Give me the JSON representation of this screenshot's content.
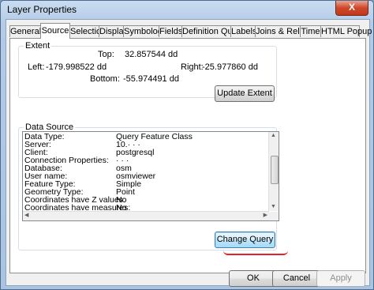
{
  "window": {
    "title": "Layer Properties",
    "close_glyph": "X"
  },
  "tabs": [
    {
      "label": "General"
    },
    {
      "label": "Source"
    },
    {
      "label": "Selection"
    },
    {
      "label": "Display"
    },
    {
      "label": "Symbology"
    },
    {
      "label": "Fields"
    },
    {
      "label": "Definition Query"
    },
    {
      "label": "Labels"
    },
    {
      "label": "Joins & Relates"
    },
    {
      "label": "Time"
    },
    {
      "label": "HTML Popup"
    }
  ],
  "active_tab": "Source",
  "extent": {
    "group_label": "Extent",
    "top_label": "Top:",
    "top_value": "32.857544 dd",
    "left_label": "Left:",
    "left_value": "-179.998522 dd",
    "right_label": "Right:",
    "right_value": "-25.977860 dd",
    "bottom_label": "Bottom:",
    "bottom_value": "-55.974491 dd",
    "update_button": "Update Extent"
  },
  "data_source": {
    "group_label": "Data Source",
    "rows": [
      {
        "key": "Data Type:",
        "value": "Query Feature Class"
      },
      {
        "key": "Server:",
        "value": "10.· · ·"
      },
      {
        "key": "Client:",
        "value": "postgresql"
      },
      {
        "key": "Connection Properties:",
        "value": "· · ·"
      },
      {
        "key": "Database:",
        "value": "osm"
      },
      {
        "key": "User name:",
        "value": "osmviewer"
      },
      {
        "key": "Feature Type:",
        "value": "Simple"
      },
      {
        "key": "Geometry Type:",
        "value": "Point"
      },
      {
        "key": "Coordinates have Z values:",
        "value": "No"
      },
      {
        "key": "Coordinates have measures:",
        "value": "No"
      }
    ],
    "change_query_button": "Change Query"
  },
  "footer": {
    "ok": "OK",
    "cancel": "Cancel",
    "apply": "Apply"
  },
  "colors": {
    "annotation_underline": "#e5202a",
    "window_frame": "#b4cbe6"
  }
}
